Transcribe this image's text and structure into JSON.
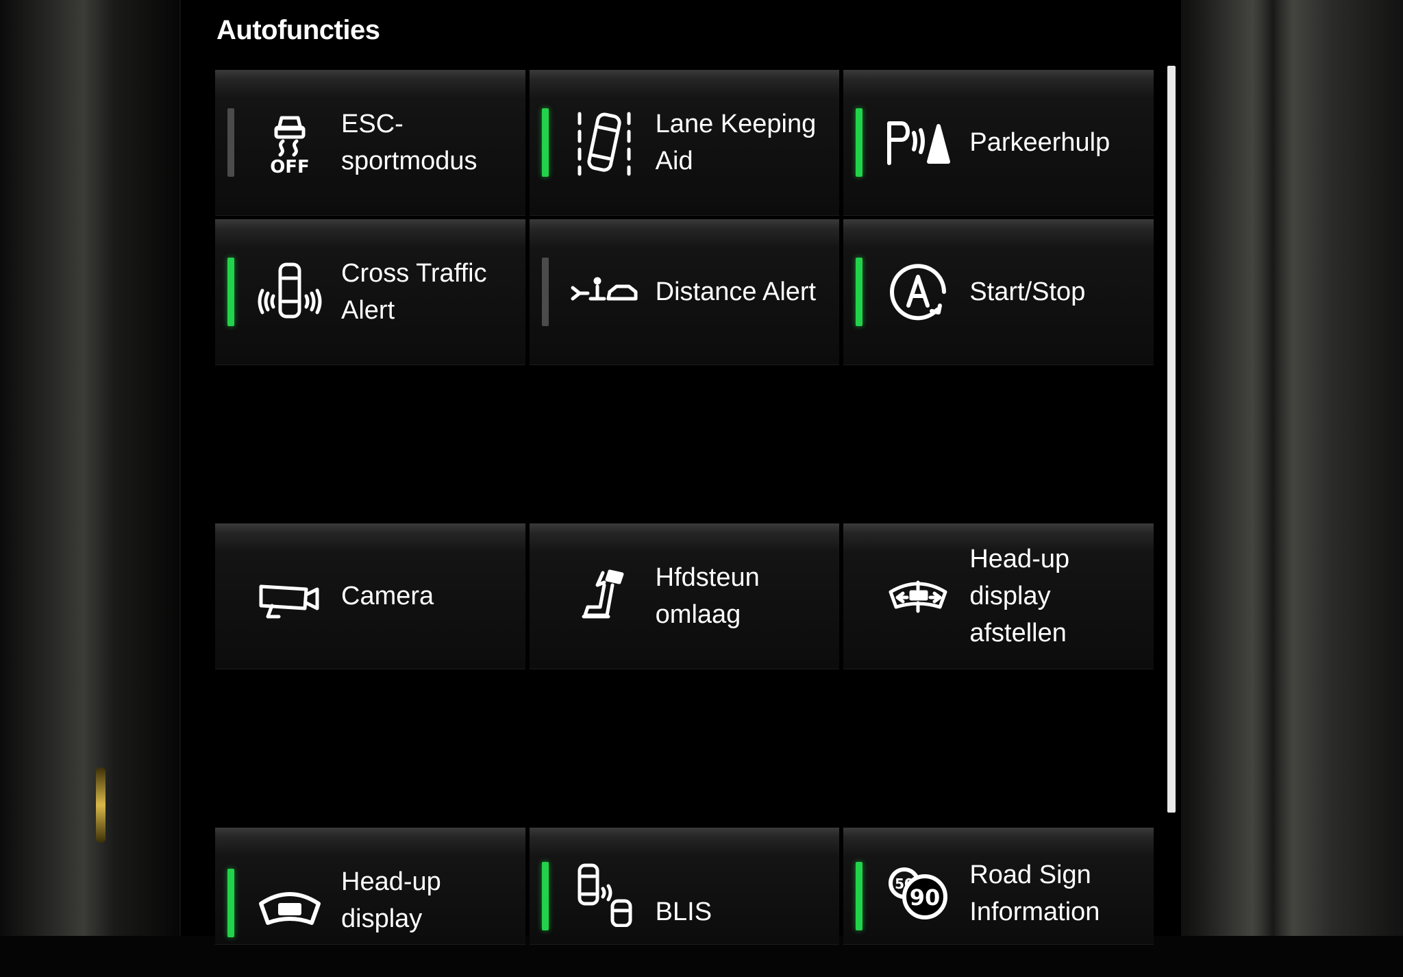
{
  "screen": {
    "title": "Autofuncties"
  },
  "tiles": [
    {
      "label": "ESC-sportmodus",
      "indicator": "off",
      "icon": "esc-off-icon"
    },
    {
      "label": "Lane Keeping Aid",
      "indicator": "on",
      "icon": "lane-keeping-icon"
    },
    {
      "label": "Parkeerhulp",
      "indicator": "on",
      "icon": "park-assist-icon"
    },
    {
      "label": "Cross Traffic Alert",
      "indicator": "on",
      "icon": "cross-traffic-icon"
    },
    {
      "label": "Distance Alert",
      "indicator": "off",
      "icon": "distance-alert-icon"
    },
    {
      "label": "Start/Stop",
      "indicator": "on",
      "icon": "start-stop-icon"
    },
    {
      "label": "Camera",
      "indicator": "none",
      "icon": "camera-icon"
    },
    {
      "label": "Hfdsteun omlaag",
      "indicator": "none",
      "icon": "headrest-icon"
    },
    {
      "label": "Head-up display afstellen",
      "indicator": "none",
      "icon": "hud-adjust-icon"
    },
    {
      "label": "Head-up display",
      "indicator": "on",
      "icon": "hud-icon"
    },
    {
      "label": "BLIS",
      "indicator": "on",
      "icon": "blis-icon"
    },
    {
      "label": "Road Sign Information",
      "indicator": "on",
      "icon": "road-sign-icon"
    }
  ],
  "colors": {
    "indicator_on": "#22d24a",
    "indicator_off": "#4b4b4b",
    "text": "#ffffff",
    "background": "#000000"
  }
}
